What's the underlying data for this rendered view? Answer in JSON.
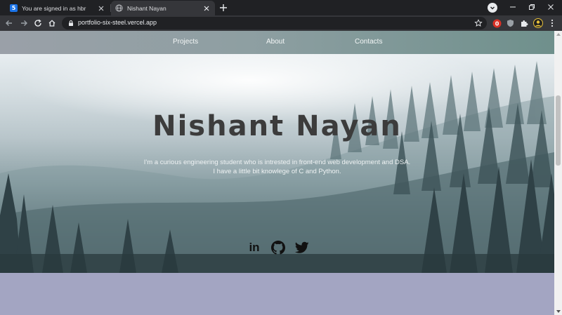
{
  "browser": {
    "tabs": [
      {
        "title": "You are signed in as hbr",
        "favicon": "5",
        "active": false
      },
      {
        "title": "Nishant Nayan",
        "favicon": "globe-icon",
        "active": true
      }
    ],
    "url": "portfolio-six-steel.vercel.app"
  },
  "site": {
    "nav": [
      {
        "label": "Projects"
      },
      {
        "label": "About"
      },
      {
        "label": "Contacts"
      }
    ],
    "hero": {
      "name": "Nishant Nayan",
      "desc_line1": "I'm a curious engineering student who is intrested in front-end web development and DSA.",
      "desc_line2": "I have a little bit knowlege of C and Python."
    },
    "socials": [
      {
        "icon": "linkedin-icon",
        "glyph": "in"
      },
      {
        "icon": "github-icon"
      },
      {
        "icon": "twitter-icon"
      }
    ]
  },
  "colors": {
    "tabstrip": "#202124",
    "toolbar": "#35363a",
    "lower_section": "#a3a5c2",
    "title": "#3c3c3c"
  }
}
